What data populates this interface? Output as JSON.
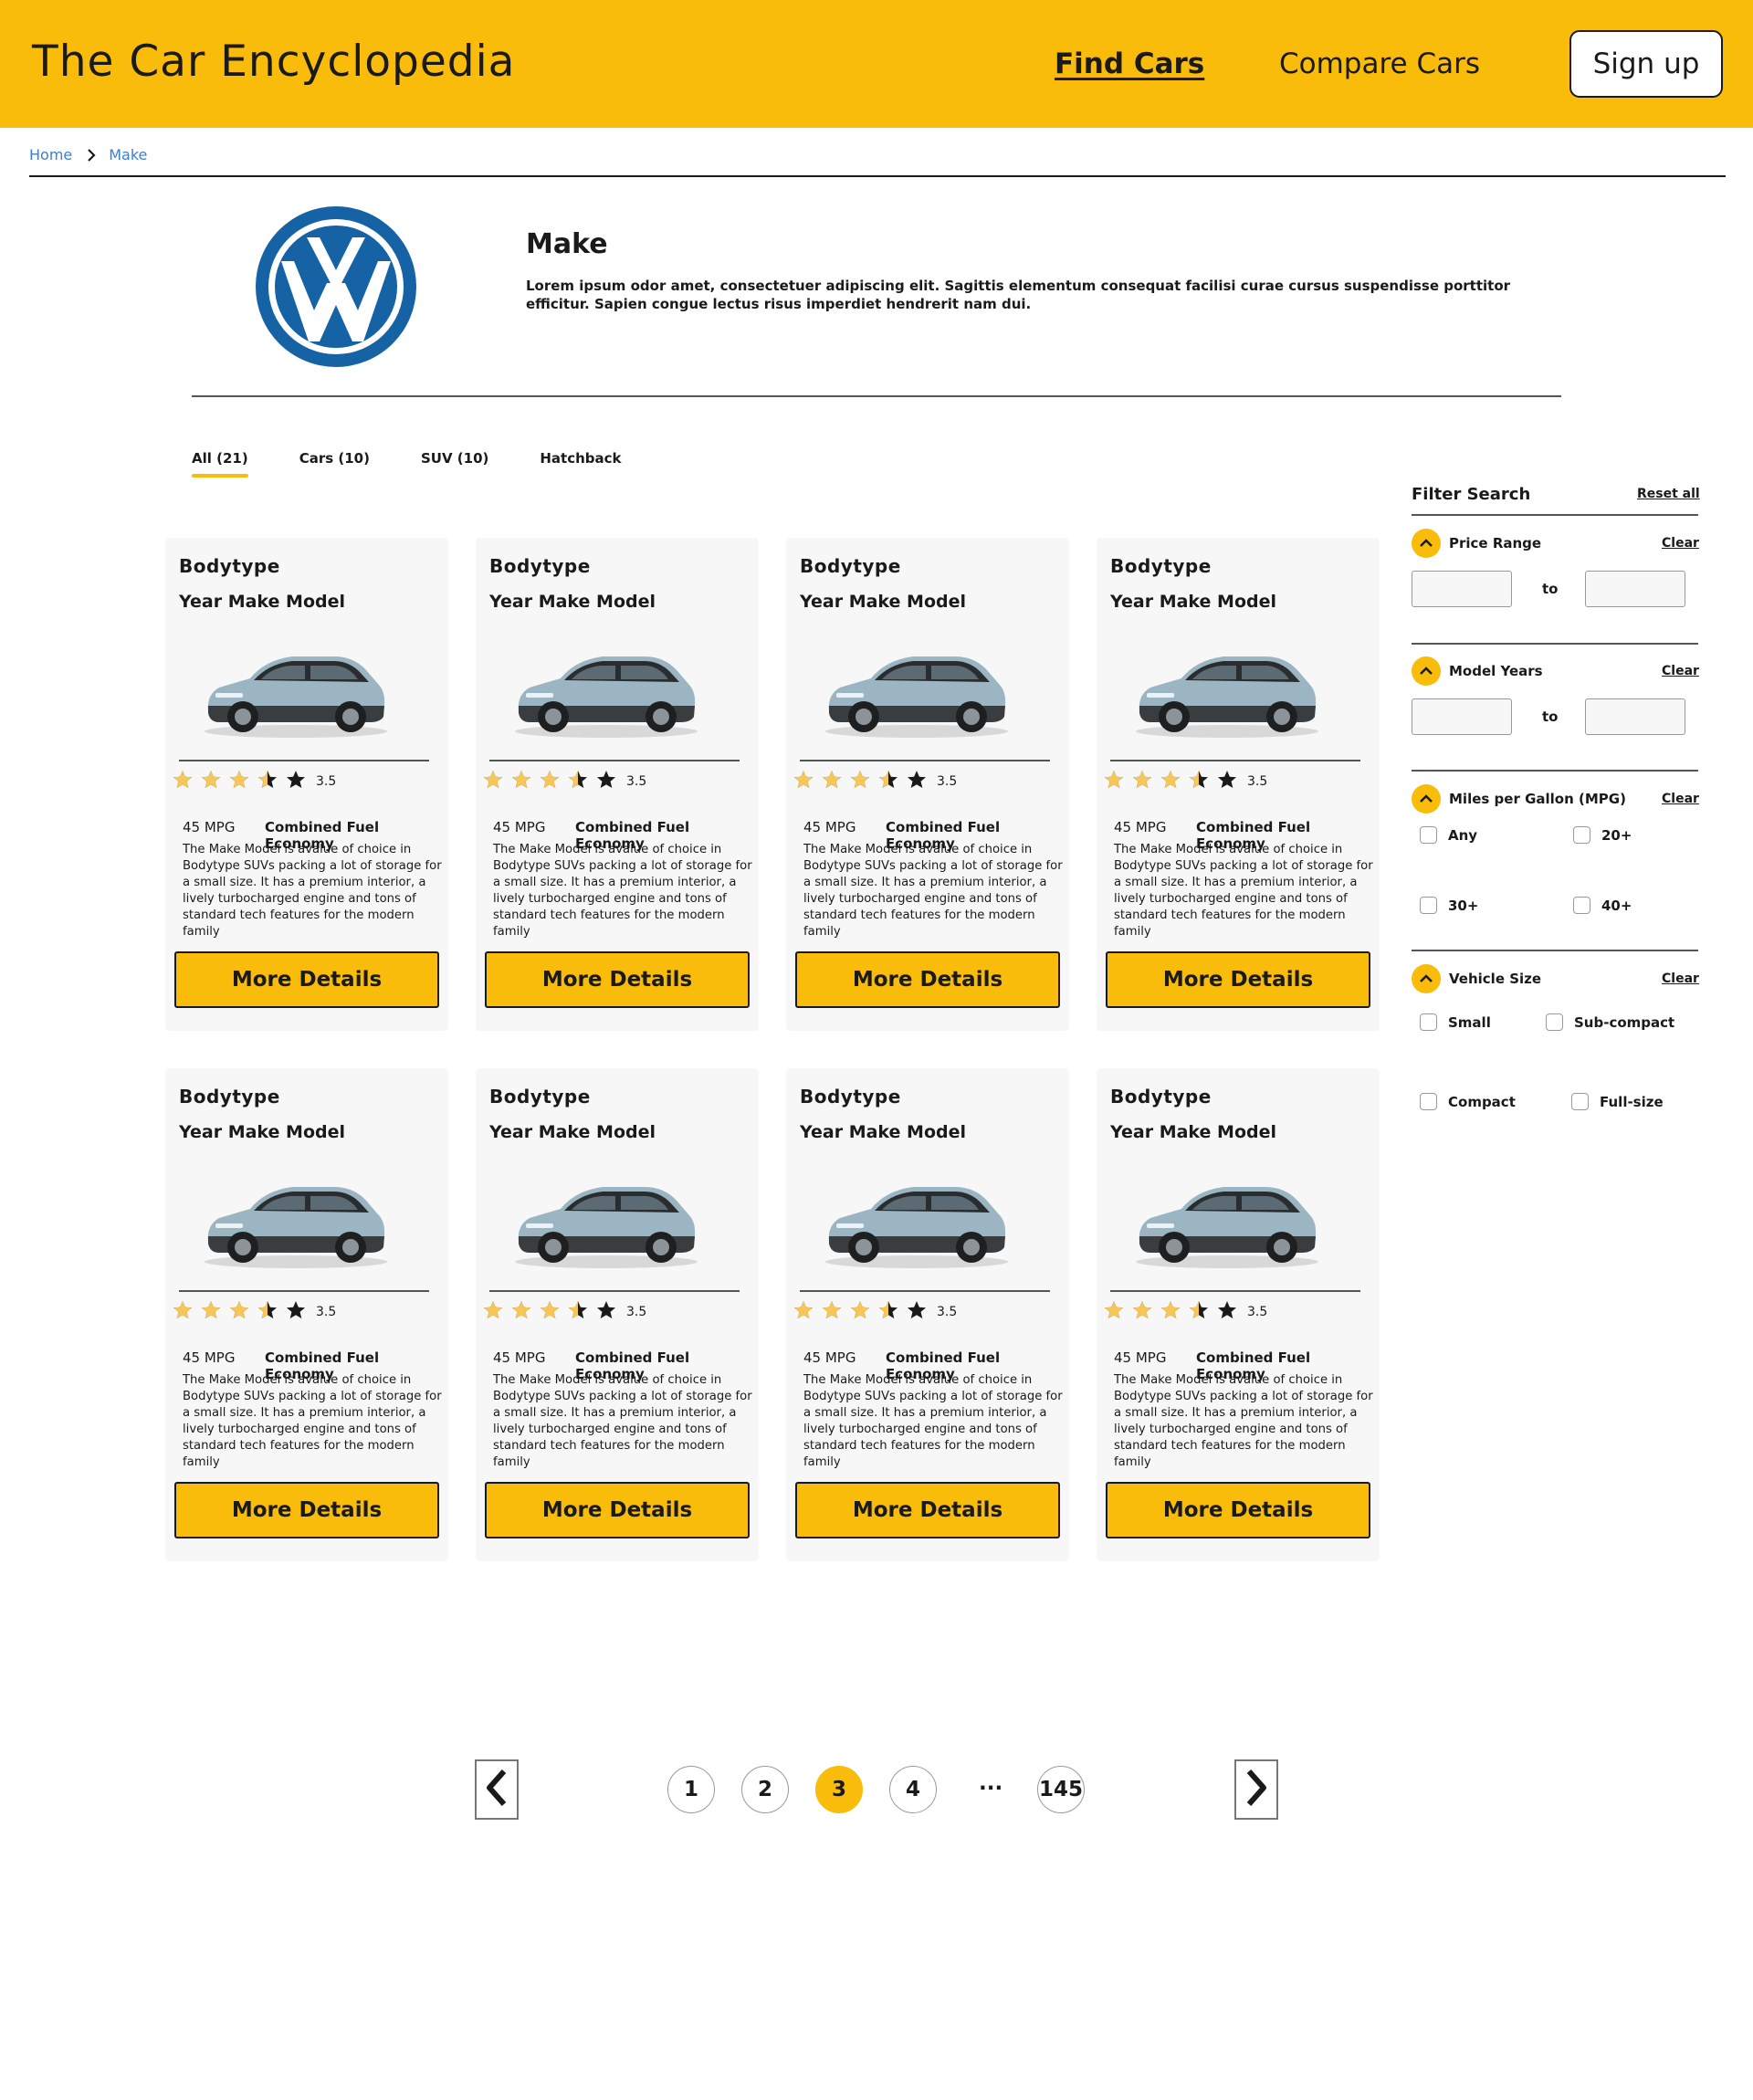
{
  "header": {
    "brand": "The Car Encyclopedia",
    "nav_find": "Find Cars",
    "nav_compare": "Compare Cars",
    "signup": "Sign up"
  },
  "breadcrumb": {
    "home": "Home",
    "current": "Make"
  },
  "make": {
    "title": "Make",
    "description": "Lorem ipsum odor amet, consectetuer adipiscing elit. Sagittis elementum consequat facilisi curae cursus suspendisse porttitor efficitur. Sapien congue lectus risus imperdiet hendrerit nam dui.",
    "logo_icon": "volkswagen-logo",
    "logo_color": "#1563A5"
  },
  "tabs": [
    {
      "label": "All (21)",
      "active": true
    },
    {
      "label": "Cars (10)",
      "active": false
    },
    {
      "label": "SUV (10)",
      "active": false
    },
    {
      "label": "Hatchback",
      "active": false
    }
  ],
  "cards": [
    {
      "bodytype": "Bodytype",
      "title": "Year Make Model",
      "rating": 3.5,
      "rating_text": "3.5",
      "mpg": "45 MPG",
      "mpg_label": "Combined Fuel Economy",
      "description": "The Make Model is avalue of choice in Bodytype SUVs packing a lot of storage for a small size. It has a premium interior, a lively turbocharged engine and tons of standard tech features for the modern family",
      "button": "More Details"
    },
    {
      "bodytype": "Bodytype",
      "title": "Year Make Model",
      "rating": 3.5,
      "rating_text": "3.5",
      "mpg": "45 MPG",
      "mpg_label": "Combined Fuel Economy",
      "description": "The Make Model is avalue of choice in Bodytype SUVs packing a lot of storage for a small size. It has a premium interior, a lively turbocharged engine and tons of standard tech features for the modern family",
      "button": "More Details"
    },
    {
      "bodytype": "Bodytype",
      "title": "Year Make Model",
      "rating": 3.5,
      "rating_text": "3.5",
      "mpg": "45 MPG",
      "mpg_label": "Combined Fuel Economy",
      "description": "The Make Model is avalue of choice in Bodytype SUVs packing a lot of storage for a small size. It has a premium interior, a lively turbocharged engine and tons of standard tech features for the modern family",
      "button": "More Details"
    },
    {
      "bodytype": "Bodytype",
      "title": "Year Make Model",
      "rating": 3.5,
      "rating_text": "3.5",
      "mpg": "45 MPG",
      "mpg_label": "Combined Fuel Economy",
      "description": "The Make Model is avalue of choice in Bodytype SUVs packing a lot of storage for a small size. It has a premium interior, a lively turbocharged engine and tons of standard tech features for the modern family",
      "button": "More Details"
    },
    {
      "bodytype": "Bodytype",
      "title": "Year Make Model",
      "rating": 3.5,
      "rating_text": "3.5",
      "mpg": "45 MPG",
      "mpg_label": "Combined Fuel Economy",
      "description": "The Make Model is avalue of choice in Bodytype SUVs packing a lot of storage for a small size. It has a premium interior, a lively turbocharged engine and tons of standard tech features for the modern family",
      "button": "More Details"
    },
    {
      "bodytype": "Bodytype",
      "title": "Year Make Model",
      "rating": 3.5,
      "rating_text": "3.5",
      "mpg": "45 MPG",
      "mpg_label": "Combined Fuel Economy",
      "description": "The Make Model is avalue of choice in Bodytype SUVs packing a lot of storage for a small size. It has a premium interior, a lively turbocharged engine and tons of standard tech features for the modern family",
      "button": "More Details"
    },
    {
      "bodytype": "Bodytype",
      "title": "Year Make Model",
      "rating": 3.5,
      "rating_text": "3.5",
      "mpg": "45 MPG",
      "mpg_label": "Combined Fuel Economy",
      "description": "The Make Model is avalue of choice in Bodytype SUVs packing a lot of storage for a small size. It has a premium interior, a lively turbocharged engine and tons of standard tech features for the modern family",
      "button": "More Details"
    },
    {
      "bodytype": "Bodytype",
      "title": "Year Make Model",
      "rating": 3.5,
      "rating_text": "3.5",
      "mpg": "45 MPG",
      "mpg_label": "Combined Fuel Economy",
      "description": "The Make Model is avalue of choice in Bodytype SUVs packing a lot of storage for a small size. It has a premium interior, a lively turbocharged engine and tons of standard tech features for the modern family",
      "button": "More Details"
    }
  ],
  "filters": {
    "title": "Filter Search",
    "reset_all": "Reset all",
    "price_range": {
      "label": "Price Range",
      "clear": "Clear",
      "to": "to",
      "min_value": "",
      "max_value": ""
    },
    "model_years": {
      "label": "Model Years",
      "clear": "Clear",
      "to": "to",
      "min_value": "",
      "max_value": ""
    },
    "mpg": {
      "label": "Miles per Gallon (MPG)",
      "clear": "Clear",
      "options": [
        "Any",
        "20+",
        "30+",
        "40+"
      ]
    },
    "vehicle_size": {
      "label": "Vehicle Size",
      "clear": "Clear",
      "options": [
        "Small",
        "Sub-compact",
        "Compact",
        "Full-size"
      ]
    }
  },
  "pagination": {
    "pages": [
      "1",
      "2",
      "3",
      "4"
    ],
    "ellipsis": "...",
    "last": "145",
    "current": "3"
  },
  "colors": {
    "accent": "#F9BC0A",
    "link": "#3A7FD5",
    "star_filled": "#F6C659",
    "star_empty": "#1A1A1A"
  }
}
